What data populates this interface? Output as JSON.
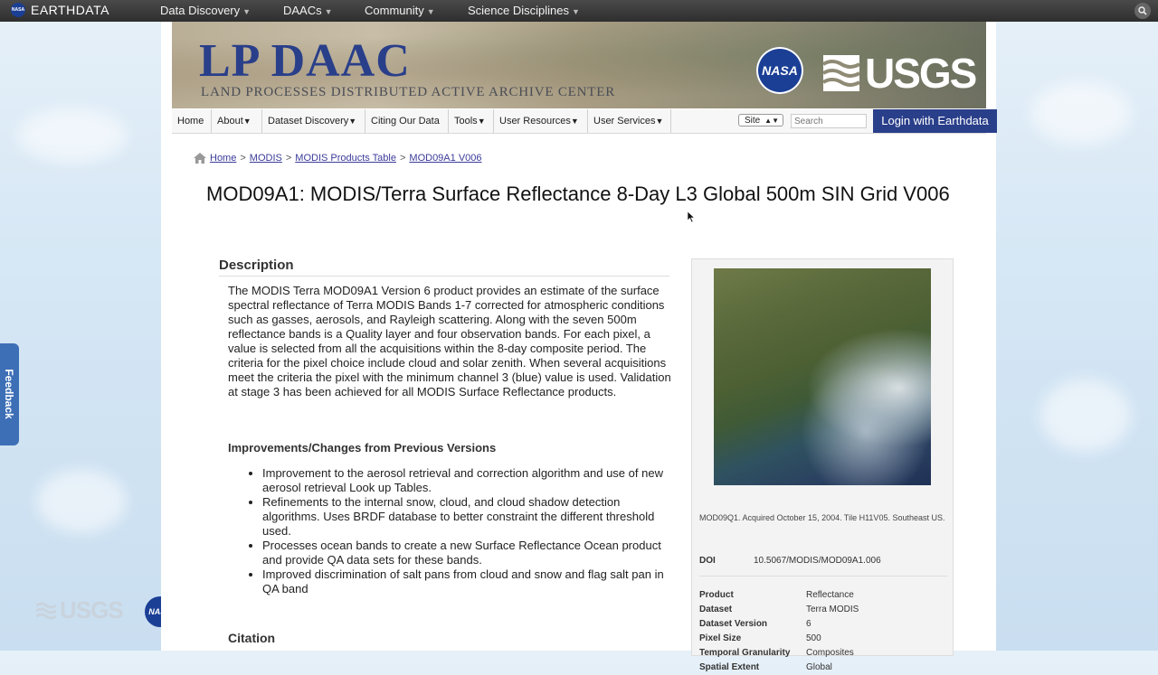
{
  "topbar": {
    "brand": "EARTHDATA",
    "nasa_mini": "NASA",
    "nav": [
      {
        "label": "Data Discovery"
      },
      {
        "label": "DAACs"
      },
      {
        "label": "Community"
      },
      {
        "label": "Science Disciplines"
      }
    ]
  },
  "banner": {
    "title": "LP DAAC",
    "subtitle": "LAND PROCESSES DISTRIBUTED ACTIVE ARCHIVE CENTER",
    "nasa_logo": "NASA",
    "usgs_logo": "USGS"
  },
  "lpnav": {
    "items": [
      {
        "label": "Home",
        "arrow": ""
      },
      {
        "label": "About",
        "arrow": "▼"
      },
      {
        "label": "Dataset Discovery",
        "arrow": "▼"
      },
      {
        "label": "Citing Our Data",
        "arrow": ""
      },
      {
        "label": "Tools",
        "arrow": "▼"
      },
      {
        "label": "User Resources",
        "arrow": "▼"
      },
      {
        "label": "User Services",
        "arrow": "▼"
      }
    ],
    "site_select": "Site",
    "search_placeholder": "Search",
    "login": "Login with Earthdata"
  },
  "breadcrumb": {
    "home": "Home",
    "modis": "MODIS",
    "products": "MODIS Products Table",
    "current": "MOD09A1 V006",
    "sep": ">"
  },
  "page_title": "MOD09A1: MODIS/Terra Surface Reflectance 8-Day L3 Global 500m SIN Grid V006",
  "description": {
    "heading": "Description",
    "text": "The MODIS Terra MOD09A1 Version 6 product provides an estimate of the surface spectral reflectance of Terra MODIS Bands 1-7 corrected for atmospheric conditions such as gasses, aerosols, and Rayleigh scattering. Along with the seven 500m reflectance bands is a Quality layer and four observation bands. For each pixel, a value is selected from all the acquisitions within the 8-day composite period. The criteria for the pixel choice include cloud and solar zenith. When several acquisitions meet the criteria the pixel with the minimum channel 3 (blue) value is used. Validation at stage 3 has been achieved for all MODIS Surface Reflectance products."
  },
  "improvements": {
    "heading": "Improvements/Changes from Previous Versions",
    "items": [
      "Improvement to the aerosol retrieval and correction algorithm and use of new aerosol retrieval Look up Tables.",
      "Refinements to the internal snow, cloud, and cloud shadow detection algorithms. Uses BRDF database to better constraint the different threshold used.",
      "Processes ocean bands to create a new Surface Reflectance Ocean product and provide QA data sets for these bands.",
      "Improved discrimination of salt pans from cloud and snow and flag salt pan in QA band"
    ]
  },
  "citation": {
    "heading": "Citation"
  },
  "sidebar": {
    "caption": "MOD09Q1. Acquired October 15, 2004. Tile H11V05. Southeast US.",
    "doi_label": "DOI",
    "doi_value": "10.5067/MODIS/MOD09A1.006",
    "attributes": [
      {
        "k": "Product",
        "v": "Reflectance"
      },
      {
        "k": "Dataset",
        "v": "Terra MODIS"
      },
      {
        "k": "Dataset Version",
        "v": "6"
      },
      {
        "k": "Pixel Size",
        "v": "500"
      },
      {
        "k": "Temporal Granularity",
        "v": "Composites"
      },
      {
        "k": "Spatial Extent",
        "v": "Global"
      }
    ]
  },
  "feedback": "Feedback",
  "footer": {
    "usgs": "USGS",
    "nasa": "NASA"
  }
}
